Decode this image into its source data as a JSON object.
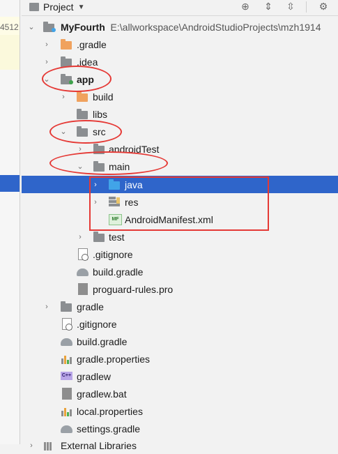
{
  "gutter": {
    "number": "4512"
  },
  "panel": {
    "title": "Project"
  },
  "toolbar_icons": [
    "target-icon",
    "expand-all-icon",
    "collapse-all-icon",
    "gear-icon"
  ],
  "tree": {
    "project": {
      "name": "MyFourth",
      "path": "E:\\allworkspace\\AndroidStudioProjects\\mzh1914"
    },
    "items": {
      "gradle_dir": ".gradle",
      "idea": ".idea",
      "app": "app",
      "build": "build",
      "libs": "libs",
      "src": "src",
      "androidTest": "androidTest",
      "main": "main",
      "java": "java",
      "res": "res",
      "manifest": "AndroidManifest.xml",
      "test": "test",
      "app_gitignore": ".gitignore",
      "app_build_gradle": "build.gradle",
      "proguard": "proguard-rules.pro",
      "gradle": "gradle",
      "root_gitignore": ".gitignore",
      "root_build_gradle": "build.gradle",
      "gradle_properties": "gradle.properties",
      "gradlew": "gradlew",
      "gradlew_bat": "gradlew.bat",
      "local_properties": "local.properties",
      "settings_gradle": "settings.gradle",
      "external": "External Libraries"
    }
  },
  "colors": {
    "selection": "#2f65ca",
    "annotation": "#e53935",
    "folder": "#8b8e91",
    "folder_orange": "#f0a25e",
    "folder_blue": "#41a4e8"
  }
}
